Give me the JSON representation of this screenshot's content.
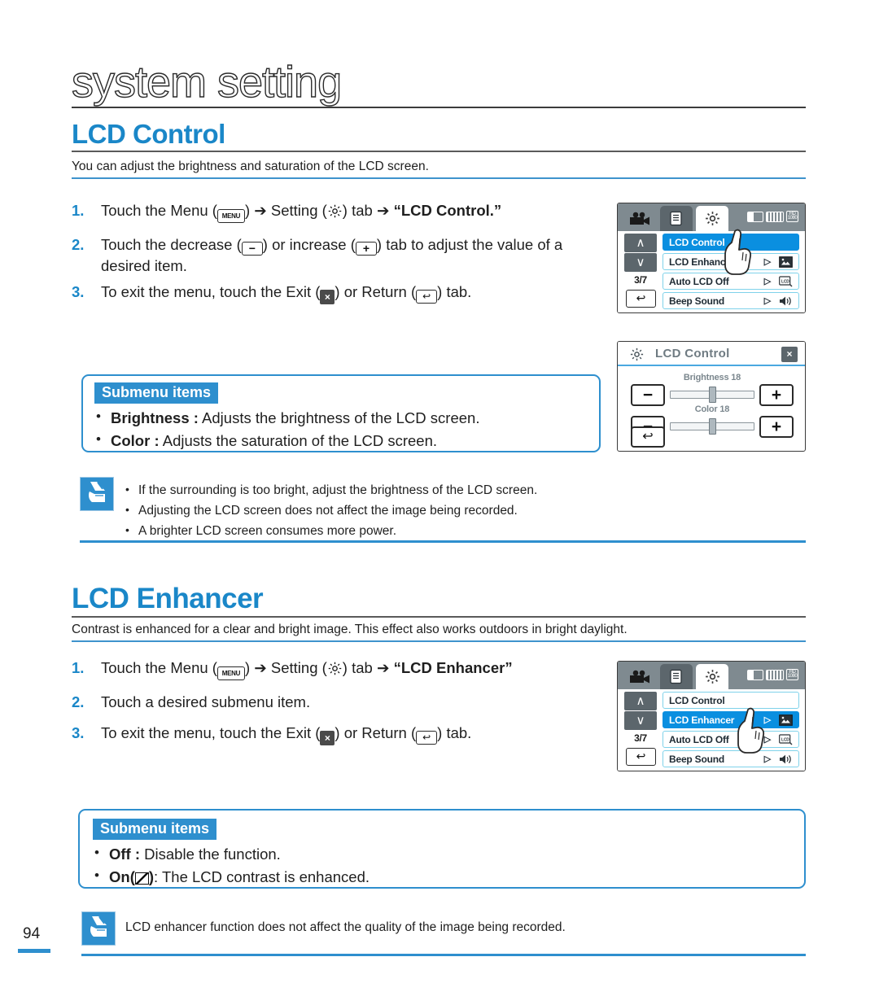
{
  "chapter": {
    "title": "system setting"
  },
  "page_number": "94",
  "sections": [
    {
      "id": "lcd-control",
      "heading": "LCD Control",
      "description": "You can adjust the brightness and saturation of the LCD screen.",
      "steps": [
        {
          "num": "1.",
          "prefix": "Touch the Menu (",
          "menu_icon": "MENU",
          "mid": ") ➔ Setting (",
          "gear_icon": "gear-icon",
          "mid2": ") tab ➔ ",
          "bold": "“LCD Control.”",
          "suffix": ""
        },
        {
          "num": "2.",
          "prefix": "Touch the decrease (",
          "minus_icon": "−",
          "mid": ") or increase (",
          "plus_icon": "+",
          "mid2": ") tab to adjust the value of a desired item.",
          "bold": "",
          "suffix": ""
        },
        {
          "num": "3.",
          "prefix": "To exit the menu, touch the Exit (",
          "exit_icon": "×",
          "mid": ") or Return (",
          "return_icon": "↩",
          "mid2": ") tab.",
          "bold": "",
          "suffix": ""
        }
      ],
      "submenu": {
        "tag": "Submenu items",
        "items": [
          {
            "bold": "Brightness :",
            "text": " Adjusts the brightness of the LCD screen."
          },
          {
            "bold": "Color :",
            "text": " Adjusts the saturation of the LCD screen."
          }
        ]
      },
      "notes": [
        "If the surrounding is too bright, adjust the brightness of the LCD screen.",
        "Adjusting the LCD screen does not affect the image being recorded.",
        "A brighter LCD screen consumes more power."
      ]
    },
    {
      "id": "lcd-enhancer",
      "heading": "LCD Enhancer",
      "description": "Contrast is enhanced for a clear and bright image. This effect also works outdoors in bright daylight.",
      "steps": [
        {
          "num": "1.",
          "prefix": "Touch the Menu (",
          "menu_icon": "MENU",
          "mid": ") ➔ Setting (",
          "gear_icon": "gear-icon",
          "mid2": ") tab ➔ ",
          "bold": "“LCD Enhancer”",
          "suffix": ""
        },
        {
          "num": "2.",
          "prefix": "Touch a desired submenu item.",
          "mid": "",
          "mid2": "",
          "bold": "",
          "suffix": ""
        },
        {
          "num": "3.",
          "prefix": "To exit the menu, touch the Exit (",
          "exit_icon": "×",
          "mid": ") or Return (",
          "return_icon": "↩",
          "mid2": ") tab.",
          "bold": "",
          "suffix": ""
        }
      ],
      "submenu": {
        "tag": "Submenu items",
        "items": [
          {
            "bold": "Off :",
            "text": " Disable the function."
          },
          {
            "bold": "On",
            "paren_icon": "lcd-enhancer-icon",
            "text": ": The LCD contrast is enhanced."
          }
        ]
      },
      "footer_note": "LCD enhancer function does not affect the quality of the image being recorded."
    }
  ],
  "lcd_mock_menu_1": {
    "tabs": [
      {
        "name": "camcorder-tab",
        "state": "inactive"
      },
      {
        "name": "playback-tab",
        "state": "inactive"
      },
      {
        "name": "setting-tab",
        "state": "active"
      }
    ],
    "page_indicator": "3/7",
    "rows": [
      {
        "label": "LCD Control",
        "selected": true,
        "arrow": "",
        "icon": ""
      },
      {
        "label": "LCD Enhancer",
        "selected": false,
        "arrow": "▷",
        "icon": "enhancer"
      },
      {
        "label": "Auto LCD Off",
        "selected": false,
        "arrow": "▷",
        "icon": "lcdoff"
      },
      {
        "label": "Beep Sound",
        "selected": false,
        "arrow": "▷",
        "icon": "beep"
      }
    ],
    "nav_up": "∧",
    "nav_down": "∨",
    "return": "↩"
  },
  "lcd_mock_control": {
    "title": "LCD Control",
    "close": "×",
    "back": "↩",
    "sliders": [
      {
        "label": "Brightness 18",
        "value": 18,
        "min": 0,
        "max": 35,
        "minus": "−",
        "plus": "+"
      },
      {
        "label": "Color 18",
        "value": 18,
        "min": 0,
        "max": 35,
        "minus": "−",
        "plus": "+"
      }
    ]
  },
  "lcd_mock_menu_2": {
    "tabs": [
      {
        "name": "camcorder-tab",
        "state": "inactive"
      },
      {
        "name": "playback-tab",
        "state": "inactive"
      },
      {
        "name": "setting-tab",
        "state": "active"
      }
    ],
    "page_indicator": "3/7",
    "rows": [
      {
        "label": "LCD Control",
        "selected": false,
        "arrow": "",
        "icon": ""
      },
      {
        "label": "LCD Enhancer",
        "selected": true,
        "arrow": "▷",
        "icon": "enhancer"
      },
      {
        "label": "Auto LCD Off",
        "selected": false,
        "arrow": "▷",
        "icon": "lcdoff"
      },
      {
        "label": "Beep Sound",
        "selected": false,
        "arrow": "▷",
        "icon": "beep"
      }
    ],
    "nav_up": "∧",
    "nav_down": "∨",
    "return": "↩"
  },
  "colors": {
    "accent_blue": "#1a87c8",
    "box_blue": "#2e8fce",
    "selected_row_blue": "#0a8fe0",
    "lcd_topbar_gray": "#7f8a90",
    "lcd_button_gray": "#5c666c"
  }
}
